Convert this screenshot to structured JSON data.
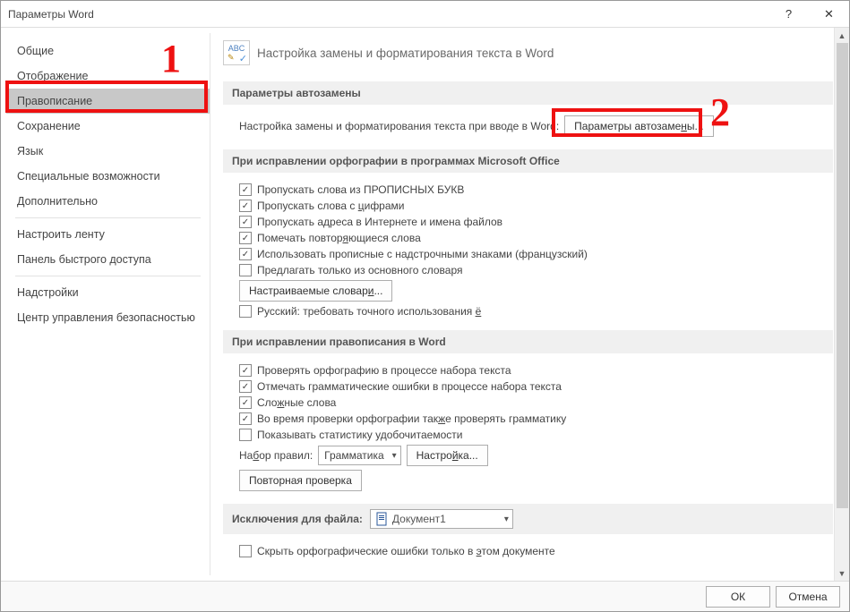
{
  "window": {
    "title": "Параметры Word"
  },
  "sidebar": {
    "items": [
      {
        "label": "Общие"
      },
      {
        "label": "Отображение"
      },
      {
        "label": "Правописание",
        "selected": true
      },
      {
        "label": "Сохранение"
      },
      {
        "label": "Язык"
      },
      {
        "label": "Специальные возможности"
      },
      {
        "label": "Дополнительно"
      }
    ],
    "group2": [
      {
        "label": "Настроить ленту"
      },
      {
        "label": "Панель быстрого доступа"
      }
    ],
    "group3": [
      {
        "label": "Надстройки"
      },
      {
        "label": "Центр управления безопасностью"
      }
    ]
  },
  "header": {
    "title": "Настройка замены и форматирования текста в Word"
  },
  "sec1": {
    "title": "Параметры автозамены",
    "desc": "Настройка замены и форматирования текста при вводе в Word:",
    "btn": "Параметры автозамены..."
  },
  "sec2": {
    "title": "При исправлении орфографии в программах Microsoft Office",
    "c1": "Пропускать слова из ПРОПИСНЫХ БУКВ",
    "c2": "Пропускать слова с цифрами",
    "c3": "Пропускать адреса в Интернете и имена файлов",
    "c4": "Помечать повторяющиеся слова",
    "c5": "Использовать прописные с надстрочными знаками (французский)",
    "c6": "Предлагать только из основного словаря",
    "btn": "Настраиваемые словари...",
    "c7": "Русский: требовать точного использования ё"
  },
  "sec3": {
    "title": "При исправлении правописания в Word",
    "c1": "Проверять орфографию в процессе набора текста",
    "c2": "Отмечать грамматические ошибки в процессе набора текста",
    "c3": "Сложные слова",
    "c4": "Во время проверки орфографии также проверять грамматику",
    "c5": "Показывать статистику удобочитаемости",
    "rules_label": "Набор правил:",
    "rules_value": "Грамматика",
    "settings_btn": "Настройка...",
    "recheck_btn": "Повторная проверка"
  },
  "sec4": {
    "title": "Исключения для файла:",
    "doc": "Документ1",
    "c1": "Скрыть орфографические ошибки только в этом документе"
  },
  "footer": {
    "ok": "ОК",
    "cancel": "Отмена"
  },
  "annotations": {
    "a1": "1",
    "a2": "2"
  }
}
